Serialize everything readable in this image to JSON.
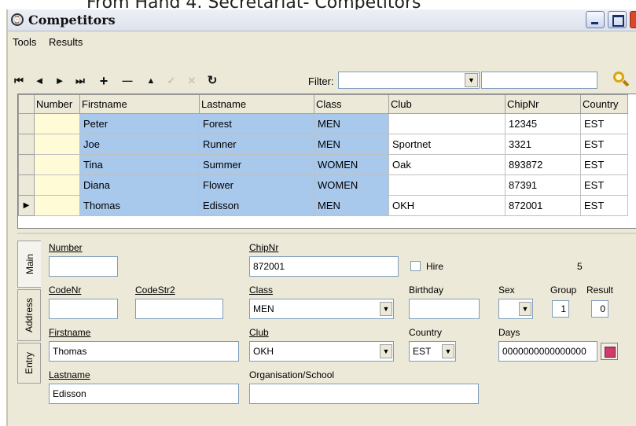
{
  "caption": "From Hand 4. Secretariat- Competitors",
  "window": {
    "title": "Competitors",
    "app_icon": "clock-icon"
  },
  "menu": {
    "items": [
      "Tools",
      "Results"
    ]
  },
  "toolbar": {
    "buttons": [
      {
        "name": "first-record-button",
        "glyph": "⏮",
        "enabled": true
      },
      {
        "name": "prev-record-button",
        "glyph": "◄",
        "enabled": true
      },
      {
        "name": "next-record-button",
        "glyph": "►",
        "enabled": true
      },
      {
        "name": "last-record-button",
        "glyph": "⏭",
        "enabled": true
      },
      {
        "name": "add-record-button",
        "glyph": "+",
        "enabled": true
      },
      {
        "name": "delete-record-button",
        "glyph": "—",
        "enabled": true
      },
      {
        "name": "edit-record-button",
        "glyph": "▲",
        "enabled": true
      },
      {
        "name": "post-record-button",
        "glyph": "✓",
        "enabled": false
      },
      {
        "name": "cancel-record-button",
        "glyph": "✕",
        "enabled": false
      },
      {
        "name": "refresh-button",
        "glyph": "↻",
        "enabled": true
      }
    ],
    "filter_label": "Filter:",
    "filter_value": "",
    "filter_text": ""
  },
  "grid": {
    "columns": [
      "Number",
      "Firstname",
      "Lastname",
      "Class",
      "Club",
      "ChipNr",
      "Country"
    ],
    "rows": [
      {
        "number": "",
        "firstname": "Peter",
        "lastname": "Forest",
        "class": "MEN",
        "club": "",
        "chipnr": "12345",
        "country": "EST"
      },
      {
        "number": "",
        "firstname": "Joe",
        "lastname": "Runner",
        "class": "MEN",
        "club": "Sportnet",
        "chipnr": "3321",
        "country": "EST"
      },
      {
        "number": "",
        "firstname": "Tina",
        "lastname": "Summer",
        "class": "WOMEN",
        "club": "Oak",
        "chipnr": "893872",
        "country": "EST"
      },
      {
        "number": "",
        "firstname": "Diana",
        "lastname": "Flower",
        "class": "WOMEN",
        "club": "",
        "chipnr": "87391",
        "country": "EST"
      },
      {
        "number": "",
        "firstname": "Thomas",
        "lastname": "Edisson",
        "class": "MEN",
        "club": "OKH",
        "chipnr": "872001",
        "country": "EST"
      }
    ],
    "current_row_marker": "▶"
  },
  "tabs": [
    "Main",
    "Address",
    "Entry"
  ],
  "form": {
    "number_label": "Number",
    "number_value": "",
    "chipnr_label": "ChipNr",
    "chipnr_value": "872001",
    "hire_label": "Hire",
    "record_count": "5",
    "codenr_label": "CodeNr",
    "codenr_value": "",
    "codestr2_label": "CodeStr2",
    "codestr2_value": "",
    "class_label": "Class",
    "class_value": "MEN",
    "birthday_label": "Birthday",
    "birthday_value": "",
    "sex_label": "Sex",
    "sex_value": "",
    "group_label": "Group",
    "group_value": "1",
    "result_label": "Result",
    "result_value": "0",
    "firstname_label": "Firstname",
    "firstname_value": "Thomas",
    "club_label": "Club",
    "club_value": "OKH",
    "country_label": "Country",
    "country_value": "EST",
    "days_label": "Days",
    "days_value": "0000000000000000",
    "lastname_label": "Lastname",
    "lastname_value": "Edisson",
    "org_label": "Organisation/School",
    "org_value": ""
  }
}
